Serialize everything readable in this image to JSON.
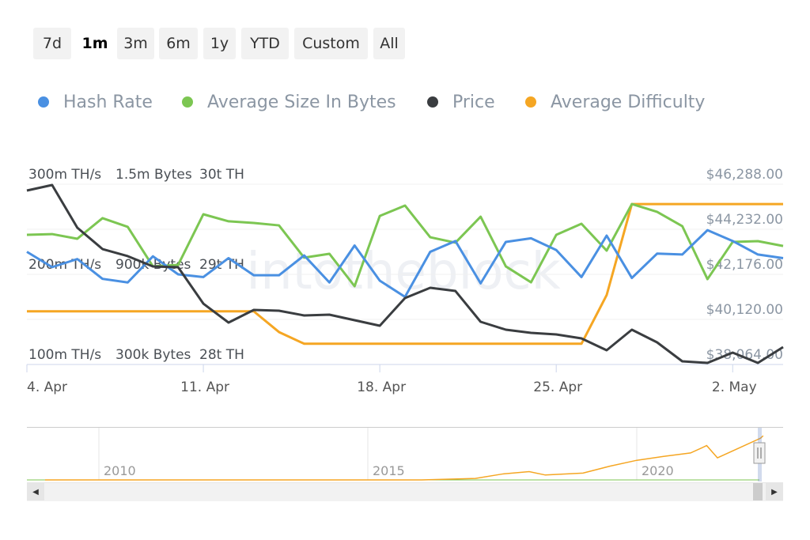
{
  "range_buttons": [
    {
      "label": "7d"
    },
    {
      "label": "1m",
      "selected": true
    },
    {
      "label": "3m"
    },
    {
      "label": "6m"
    },
    {
      "label": "1y"
    },
    {
      "label": "YTD"
    },
    {
      "label": "Custom"
    },
    {
      "label": "All"
    }
  ],
  "watermark": "intotheblock",
  "chart_data": {
    "type": "line",
    "x": [
      "4. Apr",
      "5. Apr",
      "6. Apr",
      "7. Apr",
      "8. Apr",
      "9. Apr",
      "10. Apr",
      "11. Apr",
      "12. Apr",
      "13. Apr",
      "14. Apr",
      "15. Apr",
      "16. Apr",
      "17. Apr",
      "18. Apr",
      "19. Apr",
      "20. Apr",
      "21. Apr",
      "22. Apr",
      "23. Apr",
      "24. Apr",
      "25. Apr",
      "26. Apr",
      "27. Apr",
      "28. Apr",
      "29. Apr",
      "30. Apr",
      "1. May",
      "2. May",
      "3. May",
      "4. May"
    ],
    "x_ticks": [
      "4. Apr",
      "11. Apr",
      "18. Apr",
      "25. Apr",
      "2. May"
    ],
    "legend_position": "top",
    "grid": true,
    "axes": {
      "hash": {
        "ticks": [
          "100m TH/s",
          "200m TH/s",
          "300m TH/s"
        ],
        "range": [
          100,
          300
        ]
      },
      "size": {
        "ticks": [
          "300k Bytes",
          "900k Bytes",
          "1.5m Bytes"
        ],
        "range": [
          300000,
          1500000
        ]
      },
      "difficulty": {
        "ticks": [
          "28t TH",
          "29t TH",
          "30t TH"
        ],
        "range": [
          28,
          30
        ]
      },
      "price": {
        "ticks": [
          "$38,064.00",
          "$40,120.00",
          "$42,176.00",
          "$44,232.00",
          "$46,288.00"
        ],
        "range": [
          38064,
          46288
        ]
      }
    },
    "series": [
      {
        "name": "Hash Rate",
        "axis": "hash",
        "color": "#4a90e2",
        "values": [
          225,
          208,
          217,
          195,
          191,
          220,
          200,
          197,
          218,
          199,
          199,
          221,
          191,
          232,
          193,
          175,
          225,
          237,
          190,
          236,
          240,
          227,
          197,
          243,
          196,
          223,
          222,
          249,
          237,
          222,
          218
        ]
      },
      {
        "name": "Average Size In Bytes",
        "axis": "size",
        "color": "#7cc652",
        "values": [
          1163000,
          1168000,
          1137000,
          1274000,
          1216000,
          953000,
          963000,
          1300000,
          1253000,
          1242000,
          1226000,
          1011000,
          1037000,
          821000,
          1289000,
          1358000,
          1147000,
          1111000,
          1284000,
          953000,
          847000,
          1163000,
          1237000,
          1058000,
          1368000,
          1316000,
          1221000,
          868000,
          1116000,
          1121000,
          1089000
        ]
      },
      {
        "name": "Price",
        "axis": "price",
        "color": "#3a3d40",
        "values": [
          46000,
          46252,
          44304,
          43330,
          43006,
          42537,
          42501,
          40841,
          39976,
          40553,
          40517,
          40300,
          40336,
          40084,
          39831,
          41094,
          41563,
          41418,
          40012,
          39651,
          39507,
          39435,
          39254,
          38713,
          39651,
          39074,
          38208,
          38136,
          38605,
          38136,
          38858
        ]
      },
      {
        "name": "Average Difficulty",
        "axis": "difficulty",
        "color": "#f5a623",
        "values": [
          28.59,
          28.59,
          28.59,
          28.59,
          28.59,
          28.59,
          28.59,
          28.59,
          28.59,
          28.59,
          28.36,
          28.23,
          28.23,
          28.23,
          28.23,
          28.23,
          28.23,
          28.23,
          28.23,
          28.23,
          28.23,
          28.23,
          28.23,
          28.77,
          29.78,
          29.78,
          29.78,
          29.78,
          29.78,
          29.78,
          29.78
        ]
      }
    ]
  },
  "navigator": {
    "year_labels": [
      "2010",
      "2015",
      "2020"
    ],
    "series_relative": [
      [
        2009.0,
        0
      ],
      [
        2016.0,
        0
      ],
      [
        2017.0,
        0.03
      ],
      [
        2017.5,
        0.12
      ],
      [
        2018.0,
        0.17
      ],
      [
        2018.3,
        0.1
      ],
      [
        2019.0,
        0.14
      ],
      [
        2019.5,
        0.28
      ],
      [
        2020.0,
        0.4
      ],
      [
        2020.5,
        0.48
      ],
      [
        2021.0,
        0.55
      ],
      [
        2021.3,
        0.7
      ],
      [
        2021.5,
        0.45
      ],
      [
        2021.9,
        0.65
      ],
      [
        2022.3,
        0.85
      ],
      [
        2022.35,
        0.9
      ]
    ]
  }
}
